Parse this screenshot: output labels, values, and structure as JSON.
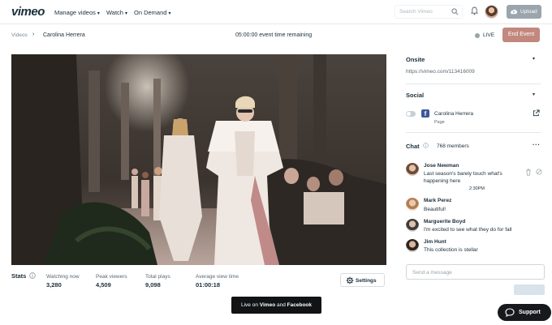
{
  "brand": {
    "logo": "vimeo"
  },
  "nav": {
    "items": [
      {
        "label": "Manage videos"
      },
      {
        "label": "Watch"
      },
      {
        "label": "On Demand"
      }
    ],
    "search_placeholder": "Search Vimeo",
    "upload_label": "Upload"
  },
  "header": {
    "breadcrumb_root": "Videos",
    "breadcrumb_current": "Carolina Herrera",
    "time_remaining": "05:00:00 event time remaining",
    "live_label": "LIVE",
    "end_event_label": "End Event"
  },
  "stats": {
    "title": "Stats",
    "items": [
      {
        "label": "Watching now",
        "value": "3,280"
      },
      {
        "label": "Peak viewers",
        "value": "4,509"
      },
      {
        "label": "Total plays",
        "value": "9,098"
      },
      {
        "label": "Average view time",
        "value": "01:00:18"
      }
    ],
    "settings_label": "Settings",
    "live_on_prefix": "Live on",
    "live_on_a": "Vimeo",
    "live_on_and": "and",
    "live_on_b": "Facebook"
  },
  "panel": {
    "onsite_title": "Onsite",
    "onsite_url": "https://vimeo.com/113416009",
    "social_title": "Social",
    "social_account": "Carolina Herrera",
    "social_sub": "Page",
    "chat_title": "Chat",
    "chat_members": "768 members",
    "messages": [
      {
        "name": "Jose Newman",
        "text": "Last season's barely touch what's happening here"
      },
      {
        "name": "Mark Perez",
        "text": "Beautiful!"
      },
      {
        "name": "Marguerite Boyd",
        "text": "I'm excited to see what they do for fall"
      },
      {
        "name": "Jim Hunt",
        "text": "This collection is stellar"
      }
    ],
    "chat_time": "2:30PM",
    "message_placeholder": "Send a message"
  },
  "support_label": "Support",
  "colors": {
    "end_event": "#c2877d",
    "facebook": "#3b5998",
    "upload": "#9aa5ad"
  }
}
